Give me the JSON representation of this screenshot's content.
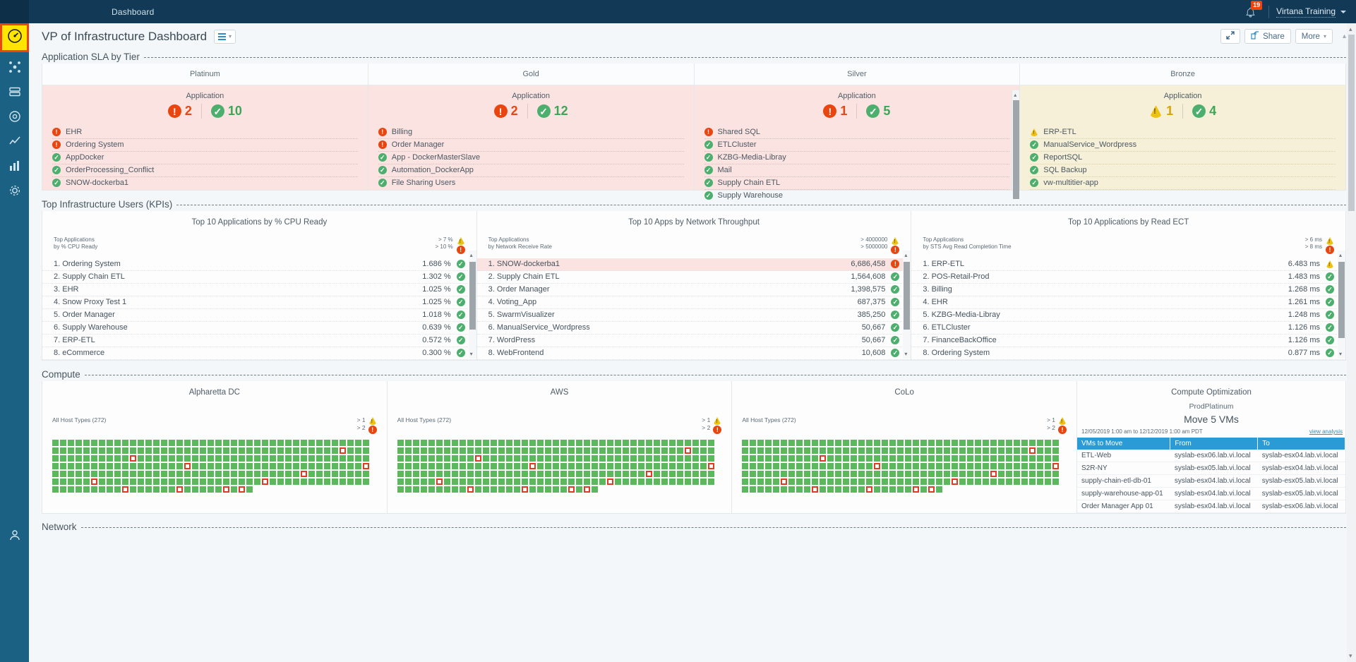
{
  "topbar": {
    "nav_label": "Dashboard",
    "notification_count": "19",
    "user": "Virtana Training",
    "bell_icon": "bell-icon",
    "caret_icon": "chevron-down-icon"
  },
  "header": {
    "title": "VP of Infrastructure Dashboard",
    "view_icon": "list-view-icon",
    "expand_icon": "expand-icon",
    "share_label": "Share",
    "share_icon": "share-icon",
    "more_label": "More",
    "collapse_icon": "chevron-up-icon"
  },
  "sections": {
    "sla": {
      "title": "Application SLA by Tier"
    },
    "kpi": {
      "title": "Top Infrastructure Users (KPIs)"
    },
    "compute": {
      "title": "Compute"
    },
    "network": {
      "title": "Network"
    }
  },
  "sla_tiers": [
    {
      "name": "Platinum",
      "sub_label": "Application",
      "tone": "red",
      "critical": "2",
      "ok": "10",
      "apps": [
        {
          "name": "EHR",
          "status": "crit"
        },
        {
          "name": "Ordering System",
          "status": "crit"
        },
        {
          "name": "AppDocker",
          "status": "ok"
        },
        {
          "name": "OrderProcessing_Conflict",
          "status": "ok"
        },
        {
          "name": "SNOW-dockerba1",
          "status": "ok"
        }
      ]
    },
    {
      "name": "Gold",
      "sub_label": "Application",
      "tone": "red",
      "critical": "2",
      "ok": "12",
      "apps": [
        {
          "name": "Billing",
          "status": "crit"
        },
        {
          "name": "Order Manager",
          "status": "crit"
        },
        {
          "name": "App - DockerMasterSlave",
          "status": "ok"
        },
        {
          "name": "Automation_DockerApp",
          "status": "ok"
        },
        {
          "name": "File Sharing Users",
          "status": "ok"
        }
      ]
    },
    {
      "name": "Silver",
      "sub_label": "Application",
      "tone": "red",
      "critical": "1",
      "ok": "5",
      "apps": [
        {
          "name": "Shared SQL",
          "status": "crit"
        },
        {
          "name": "ETLCluster",
          "status": "ok"
        },
        {
          "name": "KZBG-Media-Libray",
          "status": "ok"
        },
        {
          "name": "Mail",
          "status": "ok"
        },
        {
          "name": "Supply Chain ETL",
          "status": "ok"
        },
        {
          "name": "Supply Warehouse",
          "status": "ok"
        }
      ]
    },
    {
      "name": "Bronze",
      "sub_label": "Application",
      "tone": "amber",
      "warning": "1",
      "ok": "4",
      "apps": [
        {
          "name": "ERP-ETL",
          "status": "warn"
        },
        {
          "name": "ManualService_Wordpress",
          "status": "ok"
        },
        {
          "name": "ReportSQL",
          "status": "ok"
        },
        {
          "name": "SQL Backup",
          "status": "ok"
        },
        {
          "name": "vw-multitier-app",
          "status": "ok"
        }
      ]
    }
  ],
  "kpi_panels": [
    {
      "title": "Top 10 Applications by % CPU Ready",
      "sub_line1": "Top Applications",
      "sub_line2": "by % CPU Ready",
      "threshold_1": "> 7 %",
      "threshold_2": "> 10 %",
      "rows": [
        {
          "rank": "1.",
          "name": "Ordering System",
          "value": "1.686 %",
          "status": "ok",
          "alert": false
        },
        {
          "rank": "2.",
          "name": "Supply Chain ETL",
          "value": "1.302 %",
          "status": "ok",
          "alert": false
        },
        {
          "rank": "3.",
          "name": "EHR",
          "value": "1.025 %",
          "status": "ok",
          "alert": false
        },
        {
          "rank": "4.",
          "name": "Snow Proxy Test 1",
          "value": "1.025 %",
          "status": "ok",
          "alert": false
        },
        {
          "rank": "5.",
          "name": "Order Manager",
          "value": "1.018 %",
          "status": "ok",
          "alert": false
        },
        {
          "rank": "6.",
          "name": "Supply Warehouse",
          "value": "0.639 %",
          "status": "ok",
          "alert": false
        },
        {
          "rank": "7.",
          "name": "ERP-ETL",
          "value": "0.572 %",
          "status": "ok",
          "alert": false
        },
        {
          "rank": "8.",
          "name": "eCommerce",
          "value": "0.300 %",
          "status": "ok",
          "alert": false
        }
      ]
    },
    {
      "title": "Top 10 Apps by Network Throughput",
      "sub_line1": "Top Applications",
      "sub_line2": "by Network Receive Rate",
      "threshold_1": "> 4000000",
      "threshold_2": "> 5000000",
      "rows": [
        {
          "rank": "1.",
          "name": "SNOW-dockerba1",
          "value": "6,686,458",
          "status": "crit",
          "alert": true
        },
        {
          "rank": "2.",
          "name": "Supply Chain ETL",
          "value": "1,564,608",
          "status": "ok",
          "alert": false
        },
        {
          "rank": "3.",
          "name": "Order Manager",
          "value": "1,398,575",
          "status": "ok",
          "alert": false
        },
        {
          "rank": "4.",
          "name": "Voting_App",
          "value": "687,375",
          "status": "ok",
          "alert": false
        },
        {
          "rank": "5.",
          "name": "SwarmVisualizer",
          "value": "385,250",
          "status": "ok",
          "alert": false
        },
        {
          "rank": "6.",
          "name": "ManualService_Wordpress",
          "value": "50,667",
          "status": "ok",
          "alert": false
        },
        {
          "rank": "7.",
          "name": "WordPress",
          "value": "50,667",
          "status": "ok",
          "alert": false
        },
        {
          "rank": "8.",
          "name": "WebFrontend",
          "value": "10,608",
          "status": "ok",
          "alert": false
        }
      ]
    },
    {
      "title": "Top 10 Applications by Read ECT",
      "sub_line1": "Top Applications",
      "sub_line2": "by STS Avg Read Completion Time",
      "threshold_1": "> 6 ms",
      "threshold_2": "> 8 ms",
      "rows": [
        {
          "rank": "1.",
          "name": "ERP-ETL",
          "value": "6.483 ms",
          "status": "warn",
          "alert": false
        },
        {
          "rank": "2.",
          "name": "POS-Retail-Prod",
          "value": "1.483 ms",
          "status": "ok",
          "alert": false
        },
        {
          "rank": "3.",
          "name": "Billing",
          "value": "1.268 ms",
          "status": "ok",
          "alert": false
        },
        {
          "rank": "4.",
          "name": "EHR",
          "value": "1.261 ms",
          "status": "ok",
          "alert": false
        },
        {
          "rank": "5.",
          "name": "KZBG-Media-Libray",
          "value": "1.248 ms",
          "status": "ok",
          "alert": false
        },
        {
          "rank": "6.",
          "name": "ETLCluster",
          "value": "1.126 ms",
          "status": "ok",
          "alert": false
        },
        {
          "rank": "7.",
          "name": "FinanceBackOffice",
          "value": "1.126 ms",
          "status": "ok",
          "alert": false
        },
        {
          "rank": "8.",
          "name": "Ordering System",
          "value": "0.877 ms",
          "status": "ok",
          "alert": false
        }
      ]
    }
  ],
  "compute_sites": [
    {
      "name": "Alpharetta DC",
      "host_label": "All Host Types (272)",
      "threshold_1": "> 1",
      "threshold_2": "> 2",
      "total_cells": 272,
      "red_indices": [
        78,
        92,
        140,
        163,
        196,
        210,
        232,
        255,
        262,
        268,
        270
      ]
    },
    {
      "name": "AWS",
      "host_label": "All Host Types (272)",
      "threshold_1": "> 1",
      "threshold_2": "> 2",
      "total_cells": 272,
      "red_indices": [
        78,
        92,
        140,
        163,
        196,
        210,
        232,
        255,
        262,
        268,
        270
      ]
    },
    {
      "name": "CoLo",
      "host_label": "All Host Types (272)",
      "threshold_1": "> 1",
      "threshold_2": "> 2",
      "total_cells": 272,
      "red_indices": [
        78,
        92,
        140,
        163,
        196,
        210,
        232,
        255,
        262,
        268,
        270
      ]
    }
  ],
  "compute_optimization": {
    "title": "Compute Optimization",
    "group": "ProdPlatinum",
    "headline": "Move 5 VMs",
    "time_range": "12/05/2019 1:00 am to 12/12/2019 1:00 am PDT",
    "link_label": "view analysis",
    "columns": [
      "VMs to Move",
      "From",
      "To"
    ],
    "rows": [
      {
        "vm": "ETL-Web",
        "from": "syslab-esx06.lab.vi.local",
        "to": "syslab-esx04.lab.vi.local"
      },
      {
        "vm": "S2R-NY",
        "from": "syslab-esx05.lab.vi.local",
        "to": "syslab-esx04.lab.vi.local"
      },
      {
        "vm": "supply-chain-etl-db-01",
        "from": "syslab-esx04.lab.vi.local",
        "to": "syslab-esx05.lab.vi.local"
      },
      {
        "vm": "supply-warehouse-app-01",
        "from": "syslab-esx04.lab.vi.local",
        "to": "syslab-esx05.lab.vi.local"
      },
      {
        "vm": "Order Manager App 01",
        "from": "syslab-esx04.lab.vi.local",
        "to": "syslab-esx06.lab.vi.local"
      }
    ]
  },
  "rail_items": [
    {
      "icon": "gauge-icon",
      "label": "performance"
    },
    {
      "icon": "topology-icon",
      "label": "topology"
    },
    {
      "icon": "storage-icon",
      "label": "storage"
    },
    {
      "icon": "target-icon",
      "label": "alerts"
    },
    {
      "icon": "line-chart-icon",
      "label": "trends"
    },
    {
      "icon": "bar-chart-icon",
      "label": "reports"
    },
    {
      "icon": "gear-icon",
      "label": "settings"
    },
    {
      "icon": "user-icon",
      "label": "profile"
    }
  ],
  "colors": {
    "brand_dark": "#123a56",
    "rail": "#1a6183",
    "accent_blue": "#2b9bd6",
    "critical": "#e8450f",
    "ok": "#4caf6d",
    "warn": "#edc211",
    "tier_red_bg": "#fbe3e2",
    "tier_amber_bg": "#f7f0d8"
  }
}
